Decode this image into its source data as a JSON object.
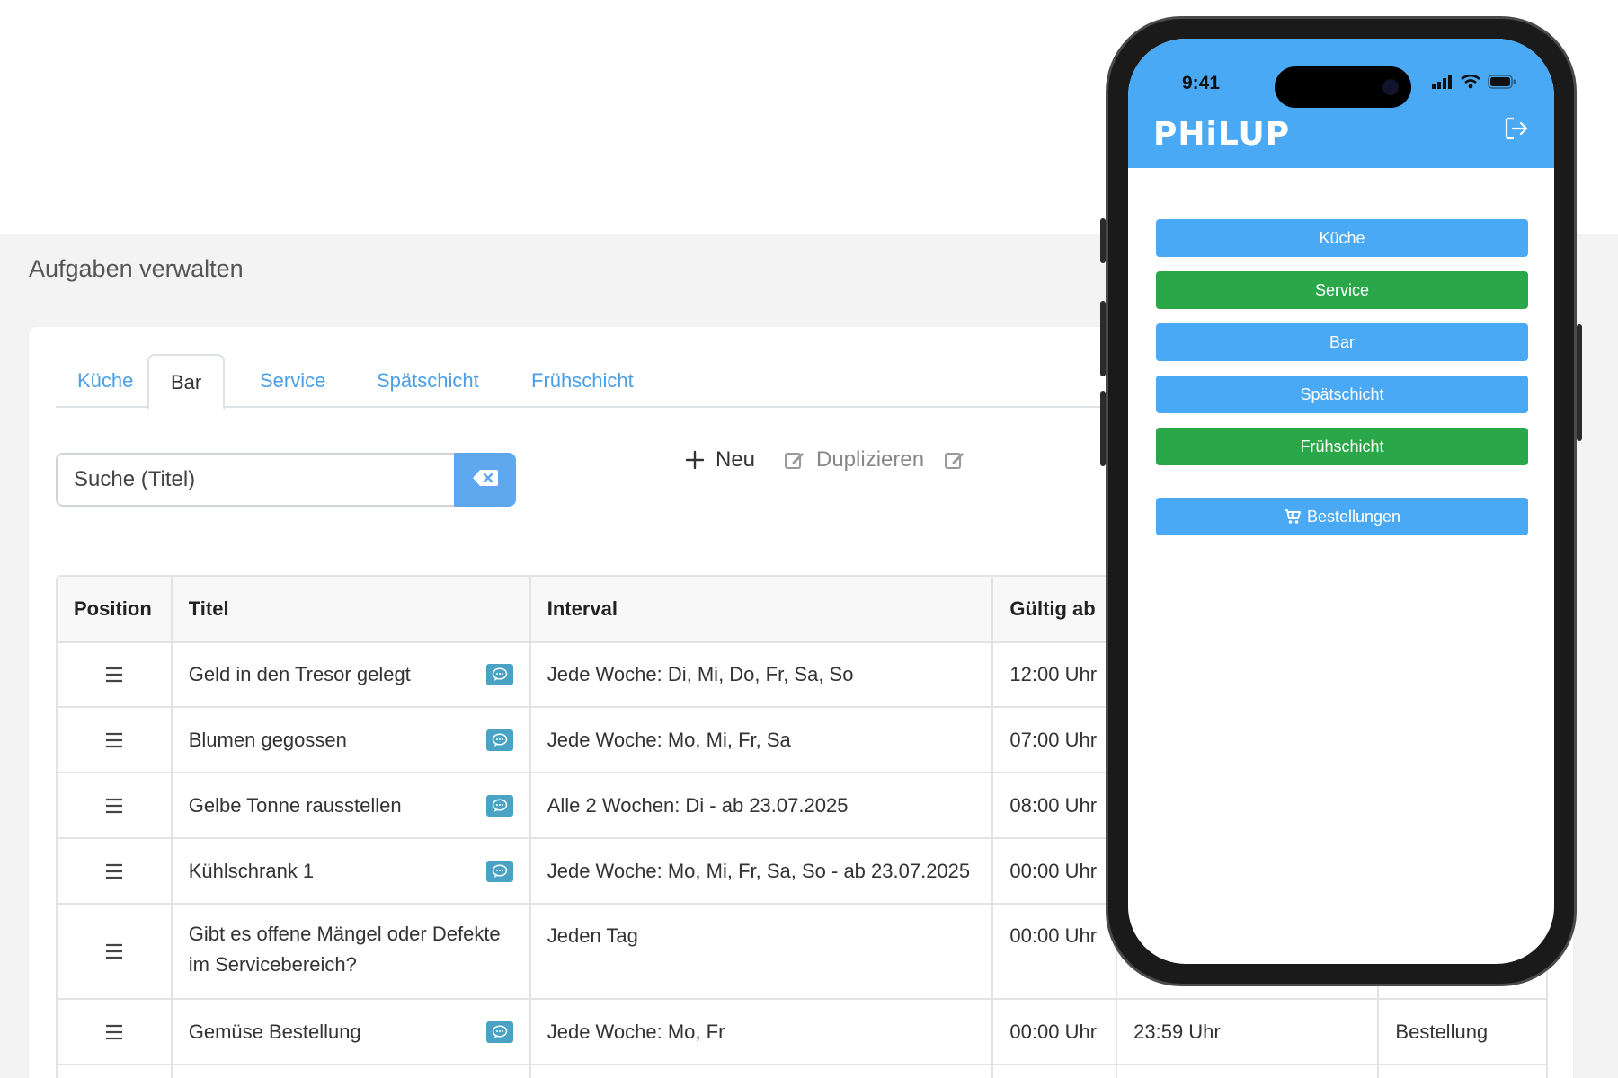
{
  "page": {
    "title": "Aufgaben verwalten"
  },
  "tabs": [
    {
      "label": "Küche",
      "active": false
    },
    {
      "label": "Bar",
      "active": true
    },
    {
      "label": "Service",
      "active": false
    },
    {
      "label": "Spätschicht",
      "active": false
    },
    {
      "label": "Frühschicht",
      "active": false
    }
  ],
  "search": {
    "placeholder": "Suche (Titel)",
    "value": ""
  },
  "toolbar": {
    "new_label": "Neu",
    "duplicate_label": "Duplizieren"
  },
  "table": {
    "headers": {
      "position": "Position",
      "title": "Titel",
      "interval": "Interval",
      "valid_from": "Gültig ab"
    },
    "rows": [
      {
        "title": "Geld in den Tresor gelegt",
        "interval": "Jede Woche: Di, Mi, Do, Fr, Sa, So",
        "valid_from": "12:00 Uhr",
        "valid_until": "",
        "type": ""
      },
      {
        "title": "Blumen gegossen",
        "interval": "Jede Woche: Mo, Mi, Fr, Sa",
        "valid_from": "07:00 Uhr",
        "valid_until": "",
        "type": ""
      },
      {
        "title": "Gelbe Tonne rausstellen",
        "interval": "Alle 2 Wochen: Di - ab 23.07.2025",
        "valid_from": "08:00 Uhr",
        "valid_until": "",
        "type": ""
      },
      {
        "title": "Kühlschrank 1",
        "interval": "Jede Woche: Mo, Mi, Fr, Sa, So - ab 23.07.2025",
        "valid_from": "00:00 Uhr",
        "valid_until": "",
        "type": ""
      },
      {
        "title": "Gibt es offene Mängel oder Defekte im Servicebereich?",
        "interval": "Jeden Tag",
        "valid_from": "00:00 Uhr",
        "valid_until": "",
        "type": ""
      },
      {
        "title": "Gemüse Bestellung",
        "interval": "Jede Woche: Mo, Fr",
        "valid_from": "00:00 Uhr",
        "valid_until": "23:59 Uhr",
        "type": "Bestellung"
      }
    ]
  },
  "phone": {
    "time": "9:41",
    "brand": "PHiLUP",
    "buttons": [
      {
        "label": "Küche",
        "color": "#4aa9f5"
      },
      {
        "label": "Service",
        "color": "#2aa748"
      },
      {
        "label": "Bar",
        "color": "#4aa9f5"
      },
      {
        "label": "Spätschicht",
        "color": "#4aa9f5"
      },
      {
        "label": "Frühschicht",
        "color": "#2aa748"
      }
    ],
    "orders_label": "Bestellungen"
  },
  "colors": {
    "accent": "#4a9fe6",
    "green": "#2aa748",
    "badge": "#4aa3c5",
    "header": "#4aa9f5"
  }
}
